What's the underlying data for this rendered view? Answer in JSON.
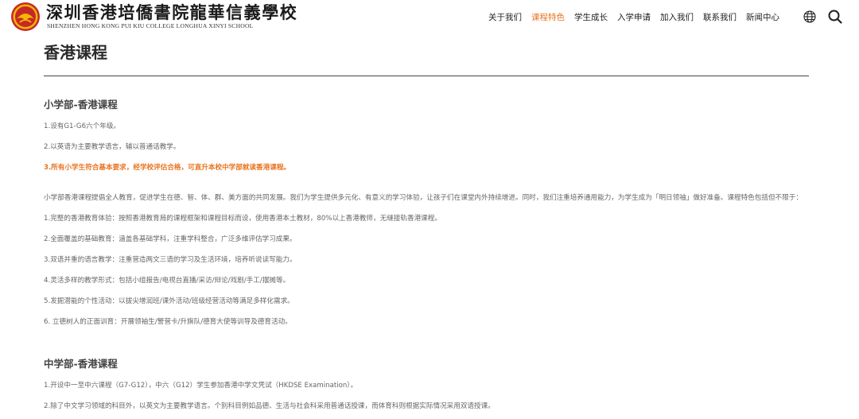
{
  "header": {
    "school_name_cn": "深圳香港培僑書院龍華信義學校",
    "school_name_en": "SHENZHEN HONG KONG PUI KIU COLLEGE LONGHUA XINYI SCHOOL",
    "nav": [
      {
        "label": "关于我们",
        "active": false
      },
      {
        "label": "课程特色",
        "active": true
      },
      {
        "label": "学生成长",
        "active": false
      },
      {
        "label": "入学申请",
        "active": false
      },
      {
        "label": "加入我们",
        "active": false
      },
      {
        "label": "联系我们",
        "active": false
      },
      {
        "label": "新闻中心",
        "active": false
      }
    ],
    "icons": [
      "school-logo",
      "globe-icon",
      "search-icon"
    ]
  },
  "page": {
    "title": "香港课程"
  },
  "primary": {
    "title": "小学部-香港课程",
    "items": [
      "1.设有G1-G6六个年级。",
      "2.以英语为主要教学语言，辅以普通话教学。",
      "3.所有小学生符合基本要求，经学校评估合格，可直升本校中学部就读香港课程。"
    ],
    "intro": "小学部香港课程提倡全人教育，促进学生在德、智、体、群、美方面的共同发展。我们为学生提供多元化、有意义的学习体验，让孩子们在课堂内外持续增进。同时，我们注重培养通用能力，为学生成为「明日领袖」做好准备。课程特色包括但不限于：",
    "features": [
      "1.完整的香港教育体验：按照香港教育局的课程框架和课程目标而设，使用香港本土教材，80%以上香港教师，无缝接轨香港课程。",
      "2.全面覆盖的基础教育：涵盖各基础学科，注重学科整合，广泛多维评估学习成果。",
      "3.双语并重的语言教学：注重营造两文三语的学习及生活环境，培养听说读写能力。",
      "4.灵活多样的教学形式：包括小组报告/电视台直播/采访/辩论/戏剧/手工/摆摊等。",
      "5.发掘潜能的个性活动：以拔尖增润班/课外活动/班级经营活动等满足多样化需求。",
      "6. 立德树人的正面训育：开展领袖生/警营卡/升旗队/德育大使等训导及德育活动。"
    ]
  },
  "secondary": {
    "title": "中学部-香港课程",
    "items": [
      "1.开设中一至中六课程（G7-G12），中六（G12）学生参加香港中学文凭试（HKDSE Examination）。",
      "2.除了中文学习领域的科目外，以英文为主要教学语言。个别科目例如品德、生活与社会科采用普通话授课，而体育科则根据实际情况采用双语授课。"
    ]
  },
  "colors": {
    "accent": "#e8731e",
    "text": "#666666",
    "heading": "#444444",
    "logo_red": "#c62828",
    "logo_gold": "#f2b705"
  }
}
